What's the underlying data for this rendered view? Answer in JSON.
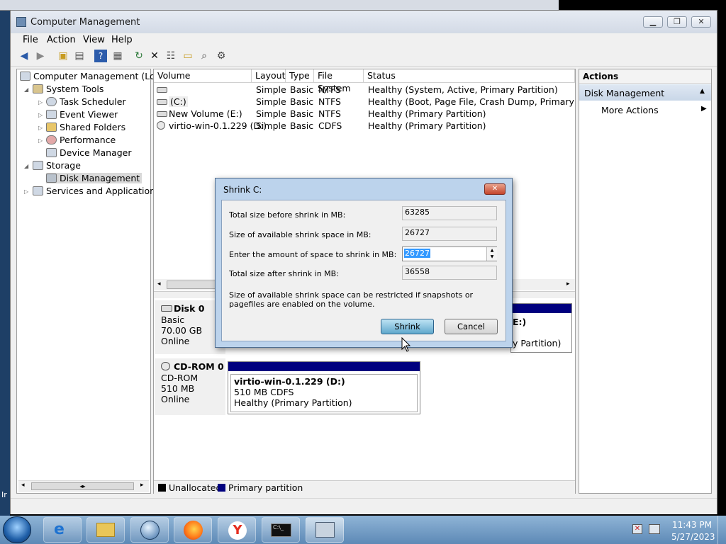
{
  "window": {
    "title": "Computer Management",
    "menu": [
      "File",
      "Action",
      "View",
      "Help"
    ],
    "caption_buttons": [
      "minimize",
      "restore",
      "close"
    ]
  },
  "toolbar_icons": [
    "back-icon",
    "forward-icon",
    "up-folder-icon",
    "show-hide-tree-icon",
    "help-icon",
    "properties-pane-icon",
    "refresh-icon",
    "delete-icon",
    "properties-icon",
    "open-folder-icon",
    "search-icon",
    "settings-icon"
  ],
  "tree": {
    "root": "Computer Management (Local",
    "system_tools": "System Tools",
    "task_scheduler": "Task Scheduler",
    "event_viewer": "Event Viewer",
    "shared_folders": "Shared Folders",
    "performance": "Performance",
    "device_manager": "Device Manager",
    "storage": "Storage",
    "disk_management": "Disk Management",
    "services": "Services and Applications"
  },
  "volumes": {
    "headers": [
      "Volume",
      "Layout",
      "Type",
      "File System",
      "Status"
    ],
    "rows": [
      {
        "volume": "",
        "layout": "Simple",
        "type": "Basic",
        "fs": "NTFS",
        "status": "Healthy (System, Active, Primary Partition)"
      },
      {
        "volume": "(C:)",
        "layout": "Simple",
        "type": "Basic",
        "fs": "NTFS",
        "status": "Healthy (Boot, Page File, Crash Dump, Primary Partition"
      },
      {
        "volume": "New Volume (E:)",
        "layout": "Simple",
        "type": "Basic",
        "fs": "NTFS",
        "status": "Healthy (Primary Partition)"
      },
      {
        "volume": "virtio-win-0.1.229 (D:)",
        "layout": "Simple",
        "type": "Basic",
        "fs": "CDFS",
        "status": "Healthy (Primary Partition)"
      }
    ]
  },
  "disks": {
    "disk0": {
      "name": "Disk 0",
      "type": "Basic",
      "size": "70.00 GB",
      "state": "Online",
      "partial_label": "E:)",
      "partial_status": "y Partition)"
    },
    "cdrom0": {
      "name": "CD-ROM 0",
      "type": "CD-ROM",
      "size": "510 MB",
      "state": "Online",
      "vol_name": "virtio-win-0.1.229  (D:)",
      "vol_size": "510 MB CDFS",
      "vol_status": "Healthy (Primary Partition)"
    }
  },
  "legend": {
    "unallocated": "Unallocated",
    "primary": "Primary partition",
    "unallocated_color": "#000000",
    "primary_color": "#00007f"
  },
  "actions": {
    "header": "Actions",
    "section": "Disk Management",
    "more": "More Actions"
  },
  "dialog": {
    "title": "Shrink C:",
    "total_before_label": "Total size before shrink in MB:",
    "total_before": "63285",
    "available_label": "Size of available shrink space in MB:",
    "available": "26727",
    "enter_label": "Enter the amount of space to shrink in MB:",
    "enter_value": "26727",
    "total_after_label": "Total size after shrink in MB:",
    "total_after": "36558",
    "note": "Size of available shrink space can be restricted if snapshots or pagefiles are enabled on the volume.",
    "shrink": "Shrink",
    "cancel": "Cancel"
  },
  "taskbar": {
    "time": "11:43 PM",
    "date": "5/27/2023",
    "apps": [
      "start-orb-icon",
      "internet-explorer-icon",
      "file-explorer-icon",
      "media-player-icon",
      "firefox-icon",
      "yandex-icon",
      "command-prompt-icon",
      "computer-management-icon"
    ]
  },
  "desktop_left_text": "Ir"
}
